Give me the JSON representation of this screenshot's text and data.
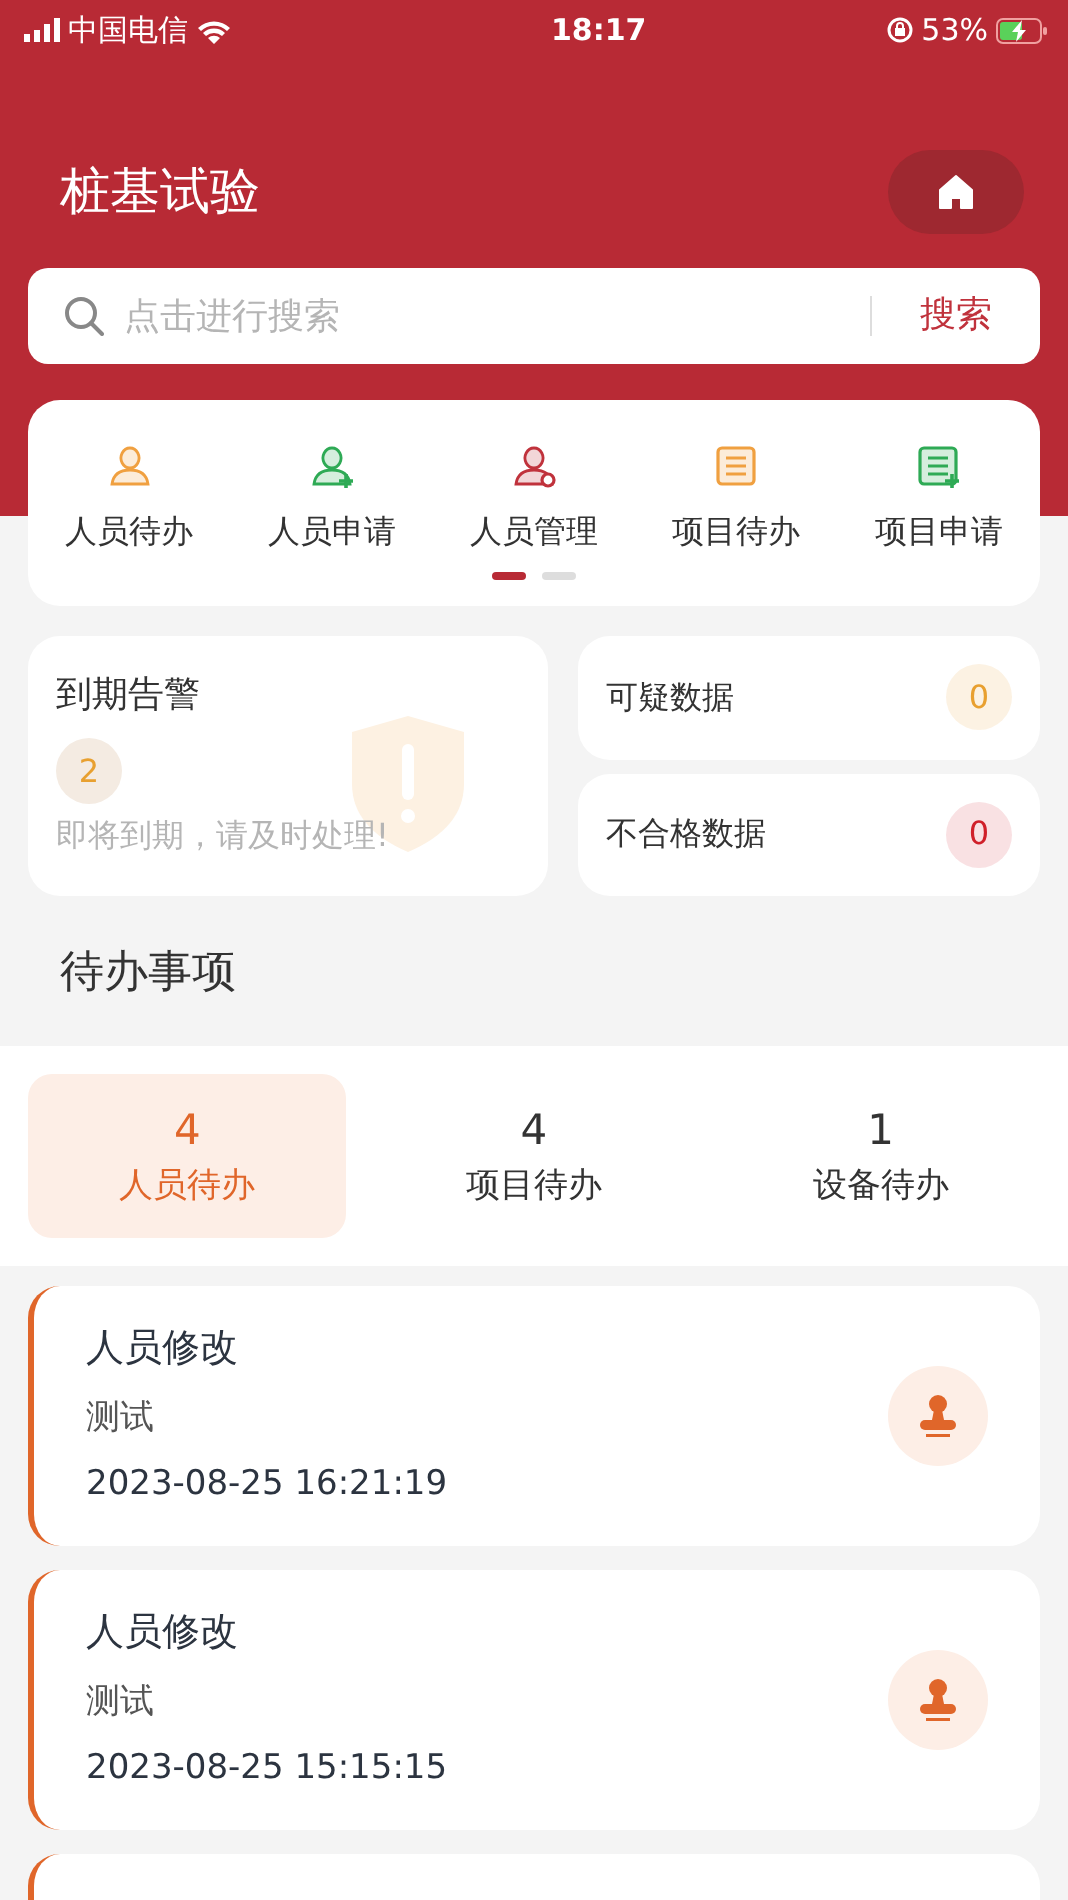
{
  "status_bar": {
    "carrier": "中国电信",
    "time": "18:17",
    "battery": "53%"
  },
  "header": {
    "title": "桩基试验"
  },
  "search": {
    "placeholder": "点击进行搜索",
    "button": "搜索"
  },
  "shortcuts": [
    {
      "label": "人员待办",
      "kind": "person",
      "color": "#f0a040"
    },
    {
      "label": "人员申请",
      "kind": "person-add",
      "color": "#2eaa55"
    },
    {
      "label": "人员管理",
      "kind": "person-gear",
      "color": "#c0323c"
    },
    {
      "label": "项目待办",
      "kind": "list",
      "color": "#f0a040"
    },
    {
      "label": "项目申请",
      "kind": "list-add",
      "color": "#2eaa55"
    }
  ],
  "pager": [
    {
      "selected": true
    },
    {
      "selected": false
    }
  ],
  "expiry_alert": {
    "title": "到期告警",
    "count": "2",
    "message": "即将到期，请及时处理!"
  },
  "data_stats": [
    {
      "label": "可疑数据",
      "count": "0",
      "color": "#e8a030"
    },
    {
      "label": "不合格数据",
      "count": "0",
      "color": "#d0202a"
    }
  ],
  "todo": {
    "title": "待办事项",
    "tabs": [
      {
        "count": "4",
        "label": "人员待办",
        "selected": true
      },
      {
        "count": "4",
        "label": "项目待办",
        "selected": false
      },
      {
        "count": "1",
        "label": "设备待办",
        "selected": false
      }
    ],
    "items": [
      {
        "title": "人员修改",
        "subtitle": "测试",
        "time": "2023-08-25 16:21:19"
      },
      {
        "title": "人员修改",
        "subtitle": "测试",
        "time": "2023-08-25 15:15:15"
      }
    ]
  }
}
